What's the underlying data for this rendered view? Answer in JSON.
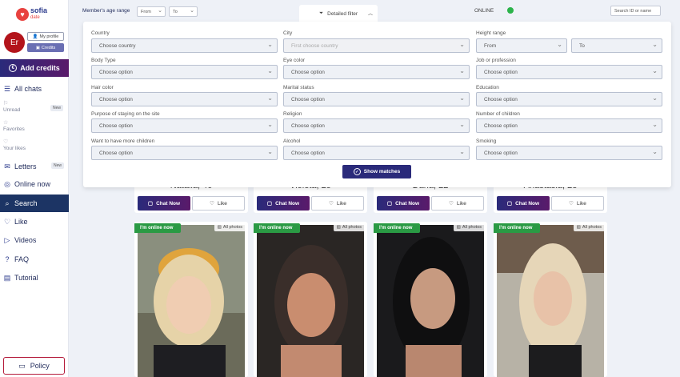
{
  "sidebar": {
    "logo_title": "sofia",
    "logo_sub": "date",
    "avatar_initials": "Er",
    "my_profile": "My profile",
    "credits": "Credits",
    "add_credits": "Add credits",
    "all_chats": "All chats",
    "unread": "Unread",
    "new_badge": "New",
    "favorites": "Favorites",
    "your_likes": "Your likes",
    "letters": "Letters",
    "online_now": "Online now",
    "search": "Search",
    "like": "Like",
    "videos": "Videos",
    "faq": "FAQ",
    "tutorial": "Tutorial",
    "policy": "Policy"
  },
  "topbar": {
    "age_range_label": "Member's age range",
    "from": "From",
    "to": "To",
    "detailed_filter": "Detailed filter",
    "online": "ONLINE",
    "search_placeholder": "Search ID or name"
  },
  "filters": {
    "country_label": "Country",
    "country_value": "Choose country",
    "city_label": "City",
    "city_value": "First choose country",
    "height_label": "Height range",
    "height_from": "From",
    "height_to": "To",
    "body_type_label": "Body Type",
    "eye_color_label": "Eye color",
    "job_label": "Job or profession",
    "hair_color_label": "Hair color",
    "marital_label": "Marital status",
    "education_label": "Education",
    "purpose_label": "Purpose of staying on the site",
    "religion_label": "Religion",
    "children_label": "Number of children",
    "want_children_label": "Want to have more children",
    "alcohol_label": "Alcohol",
    "smoking_label": "Smoking",
    "choose_option": "Choose option",
    "show_matches": "Show matches"
  },
  "cards_top": [
    {
      "name": "Natalia, 46"
    },
    {
      "name": "Violeta, 25"
    },
    {
      "name": "Daria, 22"
    },
    {
      "name": "Anastasia, 28"
    }
  ],
  "card_labels": {
    "chat_now": "Chat Now",
    "like": "Like",
    "online_badge": "I'm online now",
    "all_photos": "All photos"
  },
  "colors": {
    "accent": "#2a2a7a",
    "online": "#2a9a44",
    "active_nav": "#1c3464"
  }
}
